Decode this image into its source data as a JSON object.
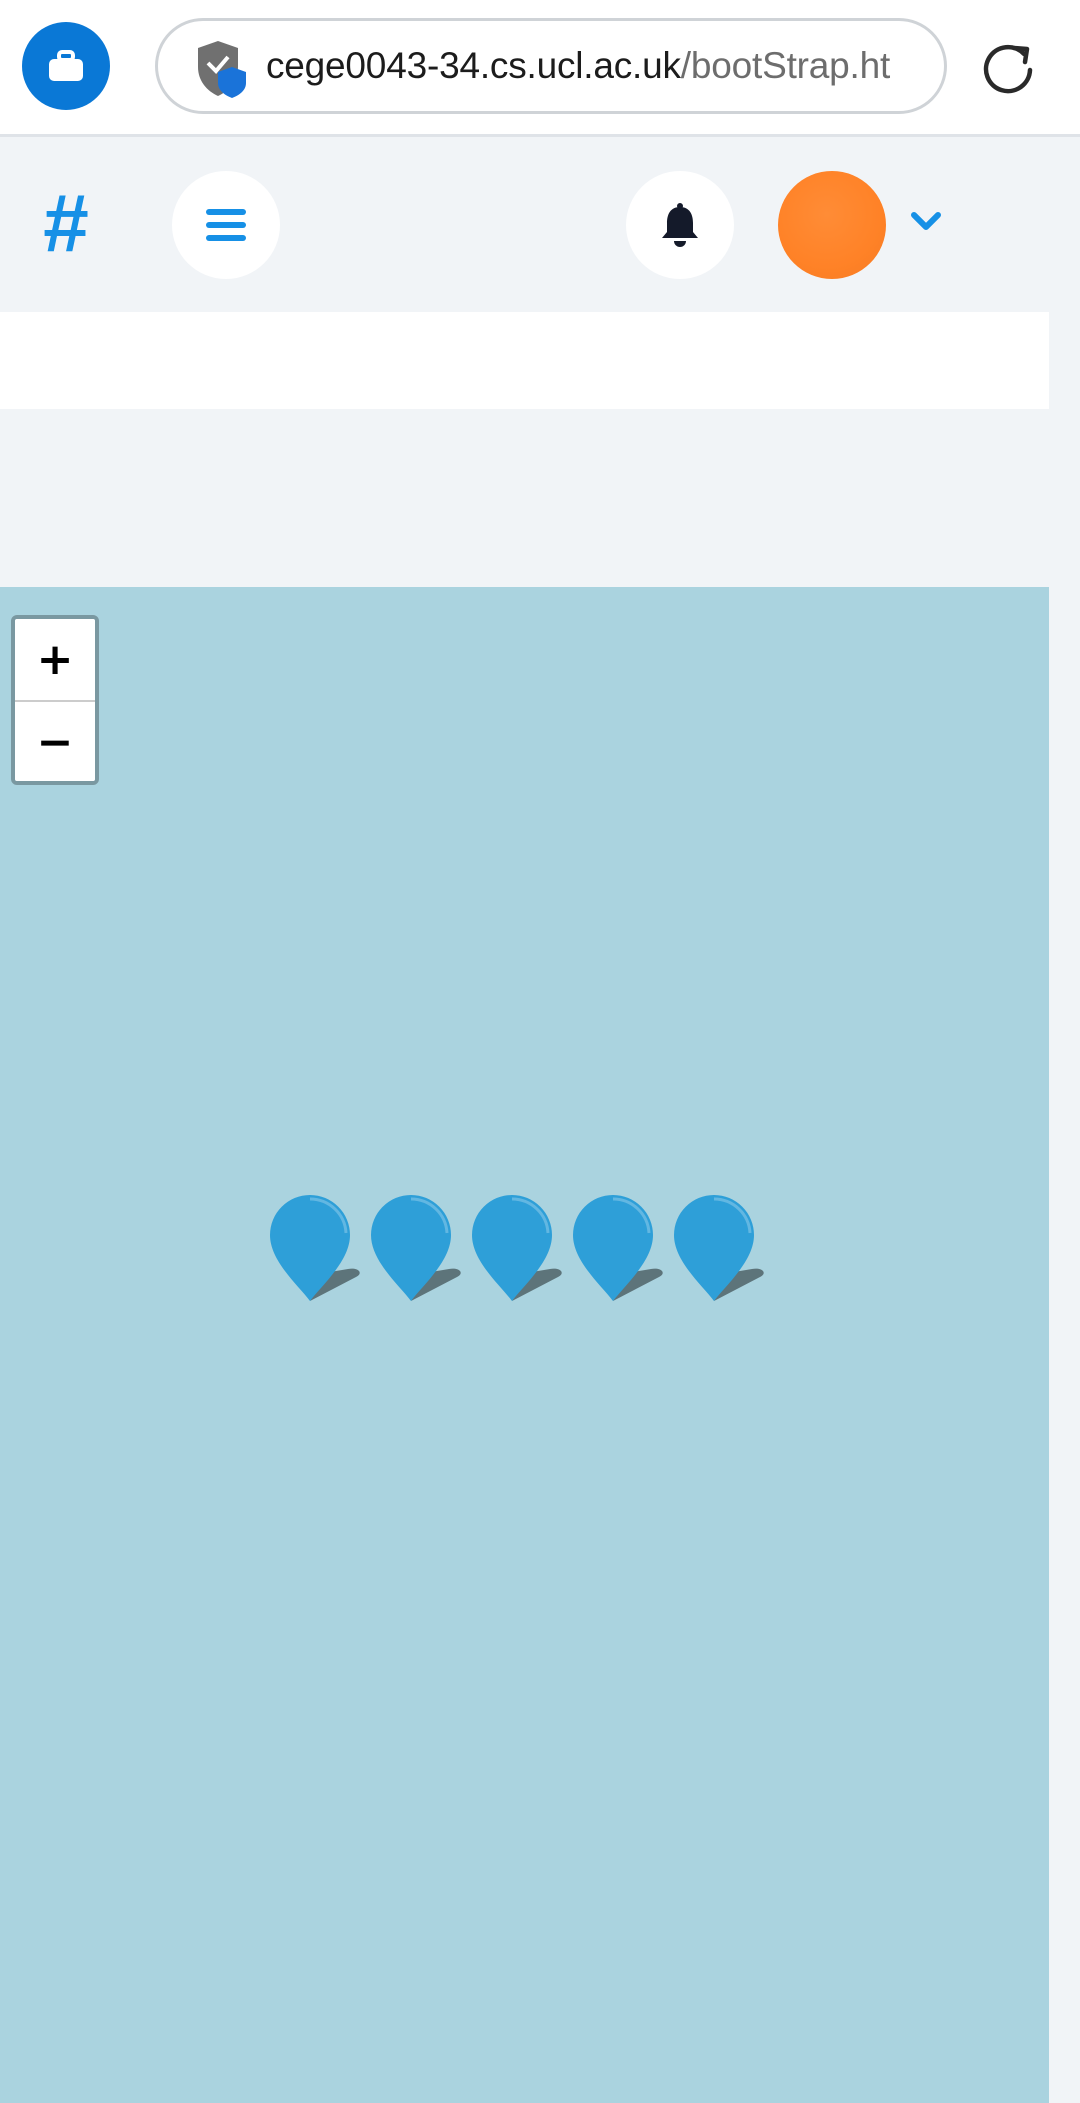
{
  "browser": {
    "url_host": "cege0043-34.cs.ucl.ac.uk",
    "url_path": "/bootStrap.ht",
    "icons": {
      "left_button": "briefcase-icon",
      "security": "shield-icon",
      "reload": "reload-icon"
    }
  },
  "navbar": {
    "brand": "#",
    "icons": {
      "menu": "hamburger-menu-icon",
      "notifications": "bell-icon",
      "avatar_dropdown": "chevron-down-icon"
    }
  },
  "map": {
    "zoom_in_label": "+",
    "zoom_out_label": "−",
    "marker_count": 5,
    "markers": [
      "marker-1",
      "marker-2",
      "marker-3",
      "marker-4",
      "marker-5"
    ]
  },
  "colors": {
    "accent": "#1690e6",
    "browser_button": "#0a78d6",
    "avatar": "#ff8227",
    "map_water": "#aad3df",
    "marker": "#2e9fd8"
  }
}
